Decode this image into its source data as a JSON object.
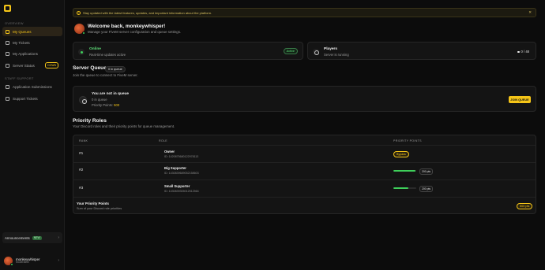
{
  "sidebar": {
    "section_overview": "OVERVIEW",
    "section_support": "STAFF SUPPORT",
    "items": [
      {
        "label": "My Queues"
      },
      {
        "label": "My Tickets"
      },
      {
        "label": "My Applications"
      },
      {
        "label": "Server Status",
        "badge": "DOWN"
      },
      {
        "label": "Application Submissions"
      },
      {
        "label": "Support Tickets"
      }
    ],
    "announcements": {
      "label": "Announcements",
      "badge": "NEW"
    },
    "user": {
      "name": "monkeywhisper",
      "role": "Moderation"
    }
  },
  "banner": {
    "text": "Stay updated with the latest features, updates, and important information about the platform."
  },
  "welcome": {
    "title": "Welcome back, monkeywhisper!",
    "subtitle": "Manage your FiveM server configuration and queue settings."
  },
  "status": {
    "online": {
      "title": "Online",
      "subtitle": "Real-time updates active",
      "pill": "Active"
    },
    "players": {
      "title": "Players",
      "subtitle": "Server is running",
      "count": "0 / 48"
    }
  },
  "queue": {
    "title": "Server Queue",
    "pill": "0 in queue",
    "subtitle": "Join the queue to connect to FiveM server.",
    "card_title": "You are not in queue",
    "line1": "0 in queue",
    "line2_prefix": "Priority Points: ",
    "line2_value": "500",
    "join_button": "JOIN QUEUE"
  },
  "priority": {
    "title": "Priority Roles",
    "subtitle": "Your Discord roles and their priority points for queue management.",
    "headers": {
      "rank": "RANK",
      "role": "ROLE",
      "points": "PRIORITY POINTS"
    },
    "rows": [
      {
        "rank": "#1",
        "name": "Owner",
        "id": "ID: 1420875680122978113",
        "points_label": "Bypass"
      },
      {
        "rank": "#2",
        "name": "Big Supporter",
        "id": "ID: 1430839689052158603",
        "points_value": 200,
        "points_label": "200 pts",
        "fill": 0.95
      },
      {
        "rank": "#3",
        "name": "Small Supporter",
        "id": "ID: 1430839305012512564",
        "points_value": 200,
        "points_label": "200 pts",
        "fill": 0.65
      }
    ],
    "your_points": {
      "title": "Your Priority Points",
      "subtitle": "Sum of your Discord role priorities",
      "value": "500 pts"
    }
  },
  "colors": {
    "accent": "#f5c518",
    "green": "#3ecf5a",
    "background": "#0c0c0c"
  }
}
